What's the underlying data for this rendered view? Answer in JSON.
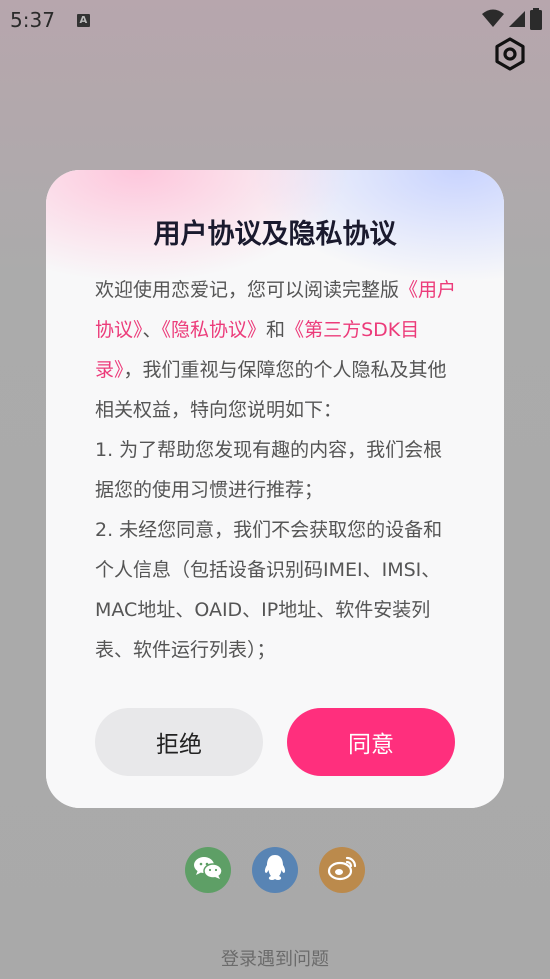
{
  "status_bar": {
    "time": "5:37",
    "notification_icon": "A"
  },
  "icons": {
    "settings": "settings-icon",
    "wifi": "wifi-icon",
    "signal": "signal-icon",
    "battery": "battery-icon",
    "wechat": "wechat-icon",
    "qq": "qq-icon",
    "weibo": "weibo-icon"
  },
  "dialog": {
    "title": "用户协议及隐私协议",
    "intro_prefix": "欢迎使用恋爱记，您可以阅读完整版",
    "link_user_agreement": "《用户协议》",
    "sep1": "、",
    "link_privacy": "《隐私协议》",
    "sep2": "和",
    "link_sdk": "《第三方SDK目录》",
    "intro_suffix": "，我们重视与保障您的个人隐私及其他相关权益，特向您说明如下：",
    "point1": "1. 为了帮助您发现有趣的内容，我们会根据您的使用习惯进行推荐；",
    "point2": "2. 未经您同意，我们不会获取您的设备和个人信息（包括设备识别码IMEI、IMSI、MAC地址、OAID、IP地址、软件安装列表、软件运行列表）；",
    "reject_label": "拒绝",
    "agree_label": "同意"
  },
  "colors": {
    "accent": "#ff2f7d",
    "link": "#ec3b7a"
  },
  "footer": {
    "login_issue": "登录遇到问题"
  }
}
